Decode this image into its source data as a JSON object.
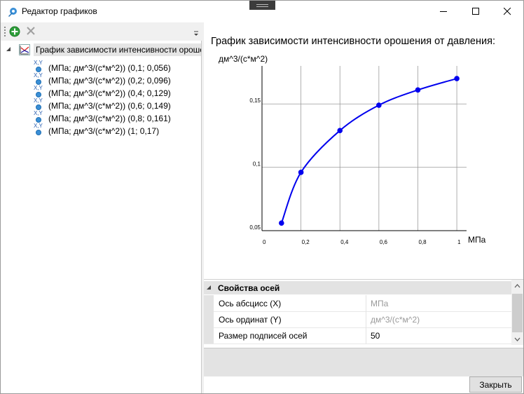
{
  "window": {
    "title": "Редактор графиков",
    "controls": [
      "minimize-icon",
      "maximize-icon",
      "close-icon"
    ]
  },
  "toolbar": {
    "add_icon": "add-icon",
    "delete_icon": "delete-icon",
    "overflow_icon": "overflow-chevron-icon"
  },
  "tree": {
    "root_label": "График зависимости интенсивности орошения от давления",
    "items": [
      {
        "label": "(МПа; дм^3/(с*м^2)) (0,1; 0,056)"
      },
      {
        "label": "(МПа; дм^3/(с*м^2)) (0,2; 0,096)"
      },
      {
        "label": "(МПа; дм^3/(с*м^2)) (0,4; 0,129)"
      },
      {
        "label": "(МПа; дм^3/(с*м^2)) (0,6; 0,149)"
      },
      {
        "label": "(МПа; дм^3/(с*м^2)) (0,8; 0,161)"
      },
      {
        "label": "(МПа; дм^3/(с*м^2)) (1; 0,17)"
      }
    ],
    "item_icon_label": "X,Y"
  },
  "chart_data": {
    "type": "line",
    "title": "График зависимости интенсивности орошения от давления:",
    "xlabel": "МПа",
    "ylabel": "дм^3/(с*м^2)",
    "x": [
      0.1,
      0.2,
      0.4,
      0.6,
      0.8,
      1.0
    ],
    "y": [
      0.056,
      0.096,
      0.129,
      0.149,
      0.161,
      0.17
    ],
    "xlim": [
      0,
      1.05
    ],
    "ylim": [
      0.05,
      0.18
    ],
    "x_ticks": [
      0,
      0.2,
      0.4,
      0.6,
      0.8,
      1
    ],
    "x_tick_labels": [
      "0",
      "0,2",
      "0,4",
      "0,6",
      "0,8",
      "1"
    ],
    "y_ticks": [
      0.05,
      0.1,
      0.15
    ],
    "y_tick_labels": [
      "0,05",
      "0,1",
      "0,15"
    ],
    "grid": true,
    "color": "#0000ee"
  },
  "properties": {
    "category": "Свойства осей",
    "rows": [
      {
        "name": "Ось абсцисс (X)",
        "value": "МПа",
        "dim": true
      },
      {
        "name": "Ось ординат (Y)",
        "value": "дм^3/(с*м^2)",
        "dim": true
      },
      {
        "name": "Размер подписей осей",
        "value": "50",
        "dim": false
      }
    ]
  },
  "footer": {
    "close_label": "Закрыть"
  }
}
